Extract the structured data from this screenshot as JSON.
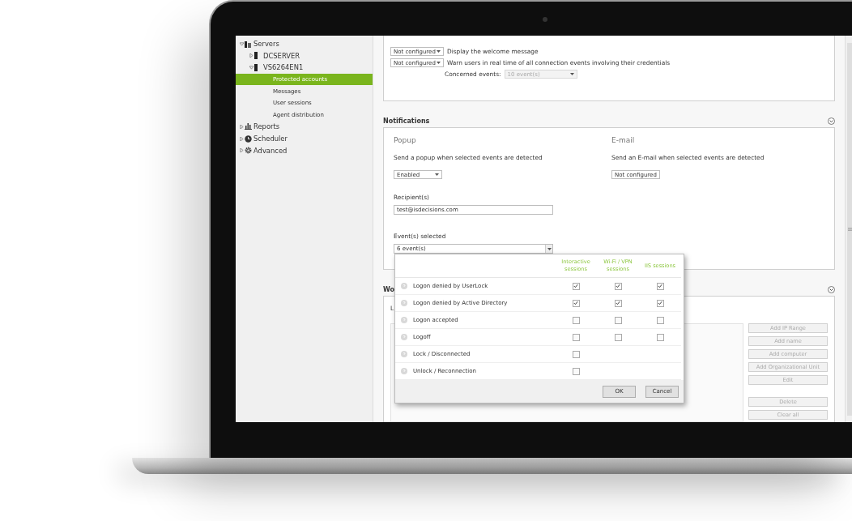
{
  "sidebar": {
    "items": [
      {
        "label": "Servers",
        "kind": "servers",
        "expanded": true,
        "children": [
          {
            "label": "DCSERVER",
            "kind": "server",
            "expanded": false
          },
          {
            "label": "VS6264EN1",
            "kind": "server",
            "expanded": true,
            "children": [
              {
                "label": "Protected accounts",
                "kind": "page",
                "selected": true
              },
              {
                "label": "Messages",
                "kind": "page",
                "selected": false
              },
              {
                "label": "User sessions",
                "kind": "page",
                "selected": false
              },
              {
                "label": "Agent distribution",
                "kind": "page",
                "selected": false
              }
            ]
          }
        ]
      },
      {
        "label": "Reports",
        "kind": "reports",
        "expanded": false
      },
      {
        "label": "Scheduler",
        "kind": "scheduler",
        "expanded": false
      },
      {
        "label": "Advanced",
        "kind": "advanced",
        "expanded": false
      }
    ]
  },
  "settings": [
    {
      "value": "Not configured",
      "label": "Display the welcome message"
    },
    {
      "value": "Not configured",
      "label": "Warn users in real time of all connection events involving their credentials"
    }
  ],
  "concerned_events": {
    "label": "Concerned events:",
    "value": "10 event(s)",
    "disabled": true
  },
  "notifications": {
    "title": "Notifications",
    "popup": {
      "title": "Popup",
      "description": "Send a popup when selected events are detected",
      "value": "Enabled"
    },
    "email": {
      "title": "E-mail",
      "description": "Send an E-mail when selected events are detected",
      "value": "Not configured"
    },
    "recipients": {
      "label": "Recipient(s)",
      "value": "test@isdecisions.com"
    },
    "events": {
      "label": "Event(s) selected",
      "value": "6 event(s)",
      "open": true
    }
  },
  "events_dropdown": {
    "columns": [
      "Interactive sessions",
      "Wi-Fi / VPN sessions",
      "IIS sessions"
    ],
    "rows": [
      {
        "label": "Logon denied by UserLock",
        "checks": [
          true,
          true,
          true
        ]
      },
      {
        "label": "Logon denied by Active Directory",
        "checks": [
          true,
          true,
          true
        ]
      },
      {
        "label": "Logon accepted",
        "checks": [
          false,
          false,
          false
        ]
      },
      {
        "label": "Logoff",
        "checks": [
          false,
          false,
          false
        ]
      },
      {
        "label": "Lock / Disconnected",
        "checks": [
          false
        ]
      },
      {
        "label": "Unlock / Reconnection",
        "checks": [
          false
        ]
      }
    ],
    "buttons": [
      "OK",
      "Cancel"
    ]
  },
  "section_2": {
    "title": "Wo",
    "label": "L",
    "buttons": [
      {
        "label": "Add IP Range",
        "disabled": true
      },
      {
        "label": "Add name",
        "disabled": true
      },
      {
        "label": "Add computer",
        "disabled": true
      },
      {
        "label": "Add Organizational Unit",
        "disabled": true
      },
      {
        "label": "Edit",
        "disabled": true
      }
    ],
    "buttons_2": [
      {
        "label": "Delete",
        "disabled": true
      },
      {
        "label": "Clear all",
        "disabled": true
      }
    ]
  }
}
